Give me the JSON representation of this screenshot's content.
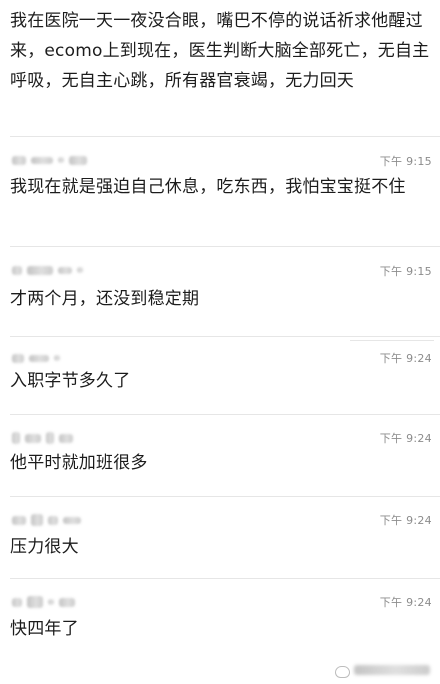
{
  "messages": [
    {
      "text": "我在医院一天一夜没合眼，嘴巴不停的说话祈求他醒过来，ecomo上到现在，医生判断大脑全部死亡，无自主呼吸，无自主心跳，所有器官衰竭，无力回天"
    },
    {
      "time": "下午 9:15",
      "text": "我现在就是强迫自己休息，吃东西，我怕宝宝挺不住"
    },
    {
      "time": "下午 9:15",
      "text": "才两个月，还没到稳定期"
    },
    {
      "time": "下午 9:24",
      "text": "入职字节多久了"
    },
    {
      "time": "下午 9:24",
      "text": "他平时就加班很多"
    },
    {
      "time": "下午 9:24",
      "text": "压力很大"
    },
    {
      "time": "下午 9:24",
      "text": "快四年了"
    }
  ]
}
